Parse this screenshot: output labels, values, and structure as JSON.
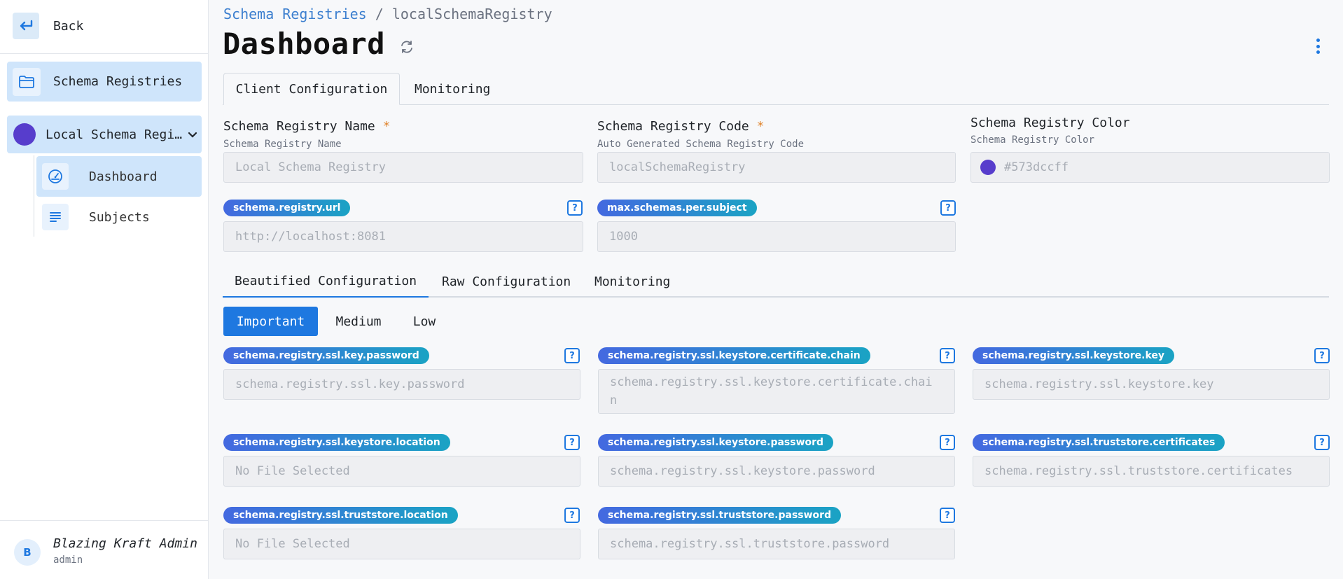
{
  "sidebar": {
    "back_label": "Back",
    "registries_label": "Schema Registries",
    "registry_name": "Local Schema Regi…",
    "registry_color": "#573dcc",
    "items": [
      {
        "label": "Dashboard",
        "icon": "gauge-icon",
        "selected": true
      },
      {
        "label": "Subjects",
        "icon": "list-icon",
        "selected": false
      }
    ],
    "user": {
      "initial": "B",
      "name": "Blazing Kraft Admin",
      "role": "admin"
    }
  },
  "breadcrumb": {
    "parent": "Schema Registries",
    "separator": "/",
    "current": "localSchemaRegistry"
  },
  "page_title": "Dashboard",
  "tabs": {
    "client_config": "Client Configuration",
    "monitoring": "Monitoring"
  },
  "form": {
    "name": {
      "label": "Schema Registry Name",
      "required": "*",
      "hint": "Schema Registry Name",
      "value": "Local Schema Registry"
    },
    "code": {
      "label": "Schema Registry Code",
      "required": "*",
      "hint": "Auto Generated Schema Registry Code",
      "value": "localSchemaRegistry"
    },
    "color": {
      "label": "Schema Registry Color",
      "hint": "Schema Registry Color",
      "value": "#573dccff"
    },
    "url": {
      "key": "schema.registry.url",
      "value": "http://localhost:8081"
    },
    "max": {
      "key": "max.schemas.per.subject",
      "value": "1000"
    }
  },
  "config_tabs": {
    "beautified": "Beautified Configuration",
    "raw": "Raw Configuration",
    "monitoring": "Monitoring"
  },
  "importance": {
    "important": "Important",
    "medium": "Medium",
    "low": "Low"
  },
  "help_glyph": "?",
  "props": [
    {
      "key": "schema.registry.ssl.key.password",
      "placeholder": "schema.registry.ssl.key.password"
    },
    {
      "key": "schema.registry.ssl.keystore.certificate.chain",
      "placeholder_line1": "schema.registry.ssl.keystore.certificate.chai",
      "placeholder_line2": "n"
    },
    {
      "key": "schema.registry.ssl.keystore.key",
      "placeholder": "schema.registry.ssl.keystore.key"
    },
    {
      "key": "schema.registry.ssl.keystore.location",
      "placeholder": "No File Selected"
    },
    {
      "key": "schema.registry.ssl.keystore.password",
      "placeholder": "schema.registry.ssl.keystore.password"
    },
    {
      "key": "schema.registry.ssl.truststore.certificates",
      "placeholder": "schema.registry.ssl.truststore.certificates"
    },
    {
      "key": "schema.registry.ssl.truststore.location",
      "placeholder": "No File Selected"
    },
    {
      "key": "schema.registry.ssl.truststore.password",
      "placeholder": "schema.registry.ssl.truststore.password"
    }
  ]
}
